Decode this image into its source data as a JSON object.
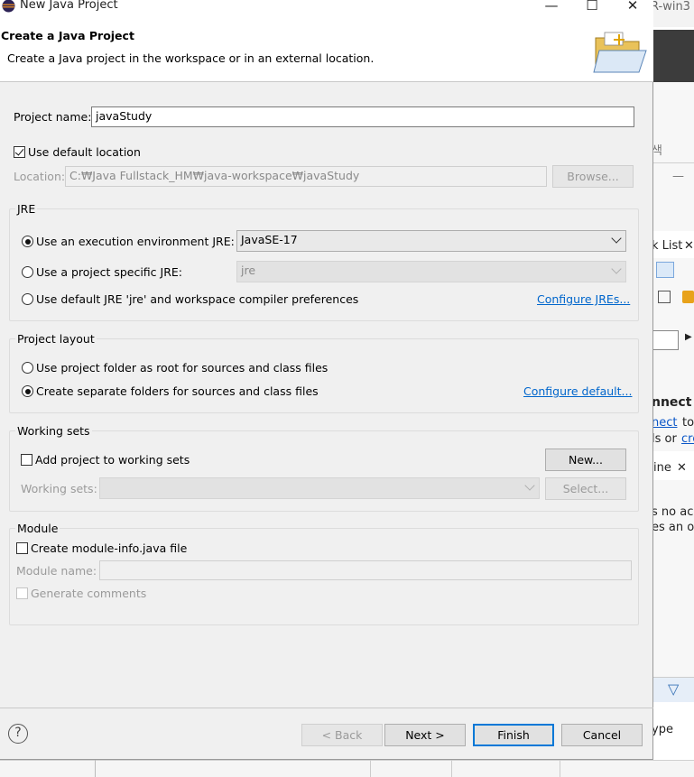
{
  "window": {
    "title": "New Java Project",
    "minimize": "—",
    "maximize": "☐",
    "close": "✕"
  },
  "header": {
    "title": "Create a Java Project",
    "description": "Create a Java project in the workspace or in an external location."
  },
  "project": {
    "name_label": "Project name:",
    "name_value": "javaStudy",
    "use_default_label": "Use default location",
    "use_default_checked": true,
    "location_label": "Location:",
    "location_value": "C:₩Java Fullstack_HM₩java-workspace₩javaStudy",
    "browse_label": "Browse..."
  },
  "jre": {
    "group_title": "JRE",
    "exec_env_label": "Use an execution environment JRE:",
    "exec_env_value": "JavaSE-17",
    "specific_label": "Use a project specific JRE:",
    "specific_value": "jre",
    "default_label": "Use default JRE 'jre' and workspace compiler preferences",
    "configure_link": "Configure JREs...",
    "selected": "exec_env"
  },
  "layout": {
    "group_title": "Project layout",
    "root_label": "Use project folder as root for sources and class files",
    "separate_label": "Create separate folders for sources and class files",
    "configure_link": "Configure default...",
    "selected": "separate"
  },
  "working_sets": {
    "group_title": "Working sets",
    "add_label": "Add project to working sets",
    "new_button": "New...",
    "sets_label": "Working sets:",
    "select_button": "Select..."
  },
  "module": {
    "group_title": "Module",
    "create_label": "Create module-info.java file",
    "name_label": "Module name:",
    "generate_label": "Generate comments"
  },
  "footer": {
    "help": "?",
    "back": "< Back",
    "next": "Next >",
    "finish": "Finish",
    "cancel": "Cancel"
  },
  "background": {
    "title_fragment": "R-win3",
    "search_fragment": "색",
    "list_fragment": "k List",
    "connect_fragment": "nnect",
    "connect_link": "nect",
    "to_fragment": "to",
    "ls_or_fragment": "ls or",
    "cre_link": "cre",
    "line_fragment": "ine",
    "no_ac_fragment": "s no ac",
    "es_an_fragment": "es an ou",
    "ype_fragment": "ype"
  }
}
